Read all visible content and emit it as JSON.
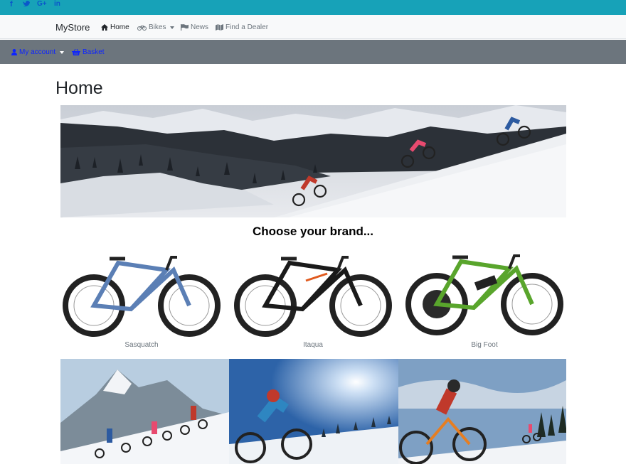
{
  "social": {
    "facebook": "f",
    "twitter": "t",
    "googleplus": "G+",
    "linkedin": "in"
  },
  "navbar": {
    "brand": "MyStore",
    "items": [
      {
        "label": "Home",
        "icon": "home-icon",
        "active": true
      },
      {
        "label": "Bikes",
        "icon": "bicycle-icon",
        "dropdown": true
      },
      {
        "label": "News",
        "icon": "flag-icon"
      },
      {
        "label": "Find a Dealer",
        "icon": "map-icon"
      }
    ]
  },
  "subbar": {
    "account": "My account",
    "basket": "Basket"
  },
  "page": {
    "title": "Home",
    "heading": "Choose your brand..."
  },
  "brands": [
    {
      "name": "Sasquatch",
      "color": "#5b7fb5"
    },
    {
      "name": "Itaqua",
      "color": "#1a1a1a"
    },
    {
      "name": "Big Foot",
      "color": "#59a52c"
    }
  ],
  "colors": {
    "topbar": "#17a2b8",
    "navbar": "#f8f9fa",
    "subbar": "#6c757d",
    "link": "#0d24ff"
  }
}
